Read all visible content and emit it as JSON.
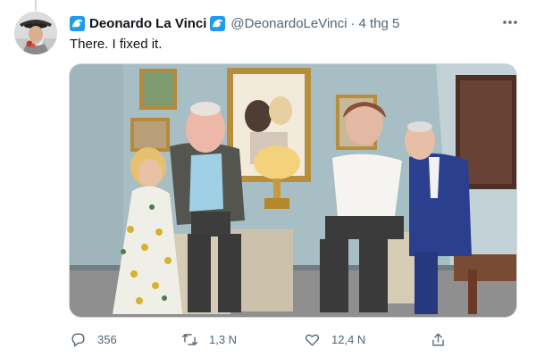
{
  "tweet": {
    "author_name": "Deonardo La Vinci",
    "handle": "@DeonardoLeVinci",
    "separator": "·",
    "date": "4 thg 5",
    "text": "There. I fixed it.",
    "badge_icon": "wave-icon",
    "media": {
      "subject": "photo",
      "icon": "photo-icon"
    }
  },
  "actions": {
    "reply": {
      "icon": "reply-icon",
      "count": "356"
    },
    "retweet": {
      "icon": "retweet-icon",
      "count": "1,3 N"
    },
    "like": {
      "icon": "heart-icon",
      "count": "12,4 N"
    },
    "share": {
      "icon": "share-icon"
    }
  },
  "colors": {
    "accent": "#1d9bf0",
    "text_primary": "#0f1419",
    "text_secondary": "#536471",
    "border": "#cfd9de"
  }
}
